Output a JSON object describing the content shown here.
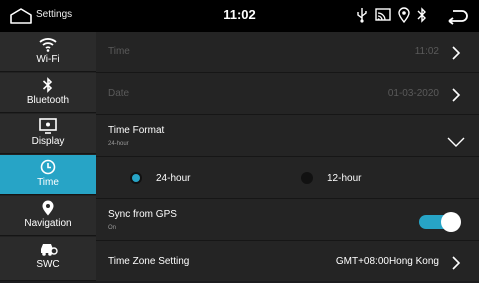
{
  "topbar": {
    "title": "Settings",
    "time": "11:02",
    "icons": [
      "home-icon",
      "usb-icon",
      "cast-icon",
      "location-icon",
      "bluetooth-icon",
      "back-icon"
    ]
  },
  "sidebar": {
    "items": [
      {
        "label": "Wi-Fi",
        "icon": "wifi-icon",
        "active": false
      },
      {
        "label": "Bluetooth",
        "icon": "bluetooth-icon",
        "active": false
      },
      {
        "label": "Display",
        "icon": "display-icon",
        "active": false
      },
      {
        "label": "Time",
        "icon": "clock-icon",
        "active": true
      },
      {
        "label": "Navigation",
        "icon": "location-pin-icon",
        "active": false
      },
      {
        "label": "SWC",
        "icon": "steering-wheel-control-icon",
        "active": false
      }
    ]
  },
  "content": {
    "time_row": {
      "label": "Time",
      "value": "11:02"
    },
    "date_row": {
      "label": "Date",
      "value": "01-03-2020"
    },
    "format_row": {
      "label": "Time Format",
      "sub": "24-hour"
    },
    "format_options": [
      {
        "label": "24-hour",
        "selected": true
      },
      {
        "label": "12-hour",
        "selected": false
      }
    ],
    "gps_row": {
      "label": "Sync from GPS",
      "sub": "On",
      "enabled": true
    },
    "timezone_row": {
      "label": "Time Zone Setting",
      "value": "GMT+08:00Hong Kong"
    }
  },
  "colors": {
    "accent": "#27a4c6",
    "background": "#242424",
    "sidebar": "#2b2b2b",
    "topbar": "#000000"
  }
}
